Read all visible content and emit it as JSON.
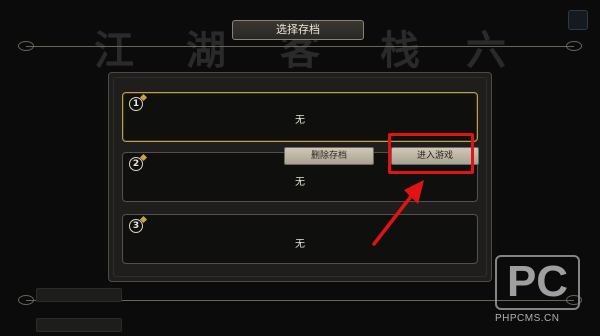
{
  "header": {
    "title": "选择存档"
  },
  "background": {
    "calligraphy": [
      "江",
      "湖",
      "客",
      "栈",
      "六"
    ]
  },
  "slots": [
    {
      "number": "1",
      "content": "无"
    },
    {
      "number": "2",
      "content": "无"
    },
    {
      "number": "3",
      "content": "无"
    }
  ],
  "actions": {
    "delete_label": "删除存档",
    "enter_label": "进入游戏"
  },
  "watermark": {
    "logo": "PC",
    "url": "PHPCMS.CN"
  },
  "colors": {
    "highlight": "#e31313",
    "selected_border": "#b9a24b"
  }
}
